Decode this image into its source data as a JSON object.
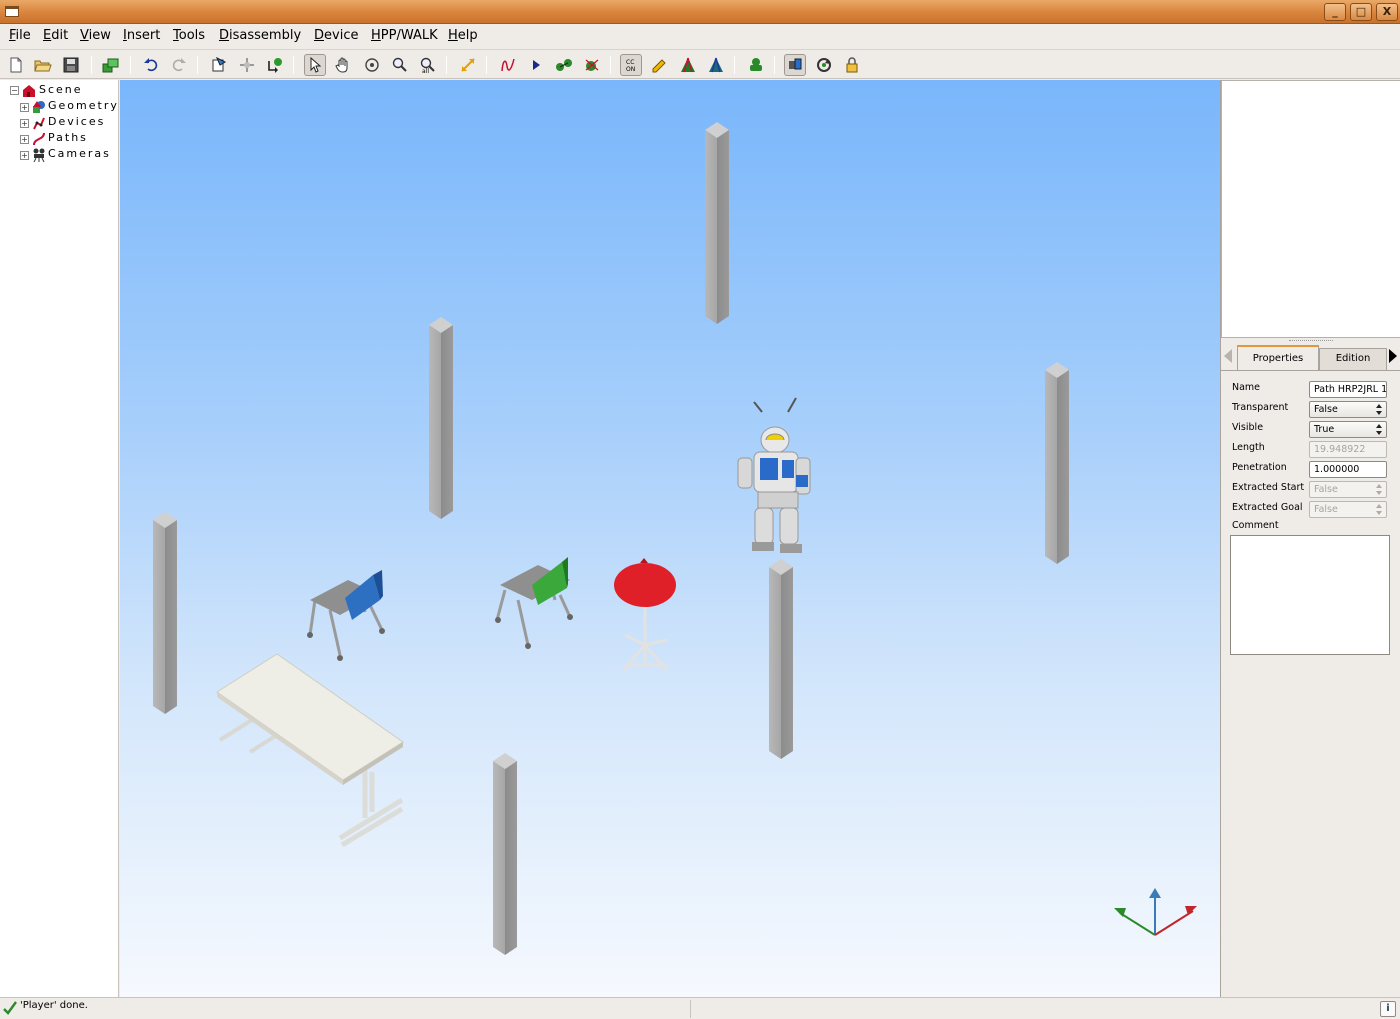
{
  "window": {
    "minimize": "_",
    "maximize": "□",
    "close": "X"
  },
  "menubar": {
    "items": [
      "File",
      "Edit",
      "View",
      "Insert",
      "Tools",
      "Disassembly",
      "Device",
      "HPP/WALK",
      "Help"
    ]
  },
  "toolbar": {
    "icons": [
      "new-icon",
      "open-folder-icon",
      "save-icon",
      "load-scene-icon",
      "undo-icon",
      "redo-icon",
      "new-geometry-icon",
      "move-object-icon",
      "collision-icon",
      "select-pointer-icon",
      "hand-pan-icon",
      "rotate-view-icon",
      "zoom-icon",
      "zoom-all-icon",
      "diagonal-arrow-icon",
      "path-curve-icon",
      "play-icon",
      "roadmap-icon",
      "roadmap-alt-icon",
      "collision-check-icon",
      "pencil-icon",
      "tree-red-icon",
      "tree-blue-icon",
      "robot-green-icon",
      "display-mode-icon",
      "refresh-cycle-icon",
      "lock-icon"
    ],
    "cc_on_label": "CC\nON"
  },
  "tree": {
    "root": "Scene",
    "children": [
      "Geometry",
      "Devices",
      "Paths",
      "Cameras"
    ],
    "expander_open": "−",
    "expander_closed": "+"
  },
  "properties": {
    "tabs": [
      "Properties",
      "Edition"
    ],
    "rows": [
      {
        "label": "Name",
        "value": "Path HRP2JRL 1",
        "kind": "text",
        "enabled": true
      },
      {
        "label": "Transparent",
        "value": "False",
        "kind": "combo",
        "enabled": true
      },
      {
        "label": "Visible",
        "value": "True",
        "kind": "combo",
        "enabled": true
      },
      {
        "label": "Length",
        "value": "19.948922",
        "kind": "text",
        "enabled": false
      },
      {
        "label": "Penetration",
        "value": "1.000000",
        "kind": "text",
        "enabled": true
      },
      {
        "label": "Extracted Start",
        "value": "False",
        "kind": "combo",
        "enabled": false
      },
      {
        "label": "Extracted Goal",
        "value": "False",
        "kind": "combo",
        "enabled": false
      }
    ],
    "comment_label": "Comment",
    "comment_value": ""
  },
  "statusbar": {
    "message": "'Player' done.",
    "info": "i"
  },
  "colors": {
    "titlebar": "#d9843c",
    "sky_top": "#79b6fb",
    "sky_bottom": "#f6f9fe",
    "pillar": "#a3a3a3",
    "chair_blue": "#2d6fc0",
    "chair_green": "#3aa83a",
    "table_red": "#e02028",
    "desk": "#efeee6"
  }
}
